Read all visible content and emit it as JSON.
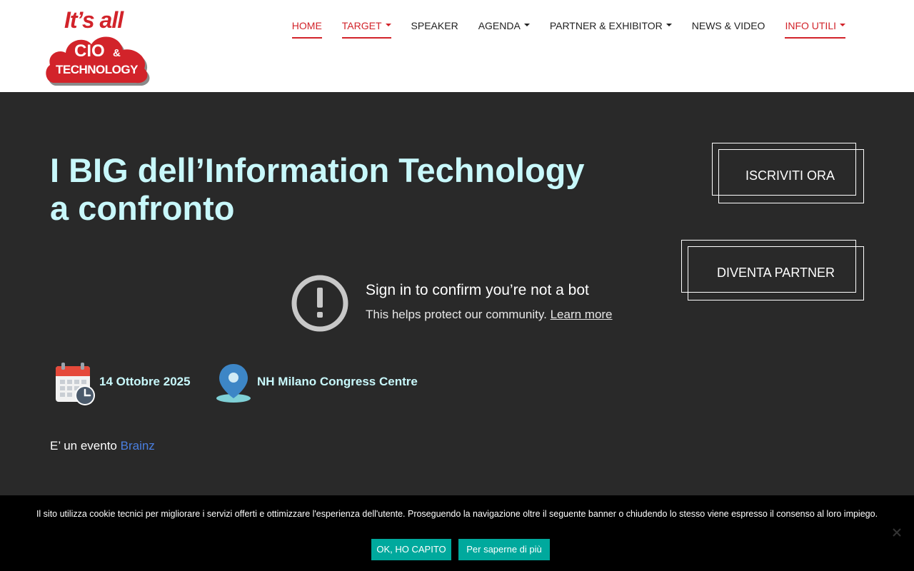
{
  "logo": {
    "line1": "It’s all",
    "line2": "CIO",
    "amp": "&",
    "line3": "TECHNOLOGY"
  },
  "nav": {
    "items": [
      {
        "label": "HOME",
        "active": true,
        "dropdown": false
      },
      {
        "label": "TARGET",
        "active": true,
        "dropdown": true
      },
      {
        "label": "SPEAKER",
        "active": false,
        "dropdown": false
      },
      {
        "label": "AGENDA",
        "active": false,
        "dropdown": true
      },
      {
        "label": "PARTNER & EXHIBITOR",
        "active": false,
        "dropdown": true
      },
      {
        "label": "NEWS & VIDEO",
        "active": false,
        "dropdown": false
      },
      {
        "label": "INFO UTILI",
        "active": true,
        "dropdown": true
      }
    ]
  },
  "hero": {
    "title_line1": "I BIG dell’Information Technology",
    "title_line2": "a confronto"
  },
  "cta": {
    "register": "ISCRIVITI ORA",
    "partner": "DIVENTA PARTNER"
  },
  "video_notice": {
    "title": "Sign in to confirm you’re not a bot",
    "subtitle": "This helps protect our community.",
    "link": "Learn more"
  },
  "event": {
    "date": "14 Ottobre 2025",
    "location": "NH Milano Congress Centre",
    "organizer_prefix": "E’ un evento",
    "organizer_name": "Brainz"
  },
  "cookie_bar": {
    "text": "Il sito utilizza cookie tecnici per migliorare i servizi offerti e ottimizzare l'esperienza dell'utente. Proseguendo la navigazione oltre il seguente banner o chiudendo lo stesso viene espresso il consenso al loro impiego.",
    "accept_label": "OK, HO CAPITO",
    "more_label": "Per saperne di più"
  },
  "colors": {
    "brand_red": "#d2232a",
    "hero_bg": "#292929",
    "title_cyan": "#c8f8fb",
    "cookie_button": "#00a99d",
    "link_blue": "#4a7fe0"
  }
}
